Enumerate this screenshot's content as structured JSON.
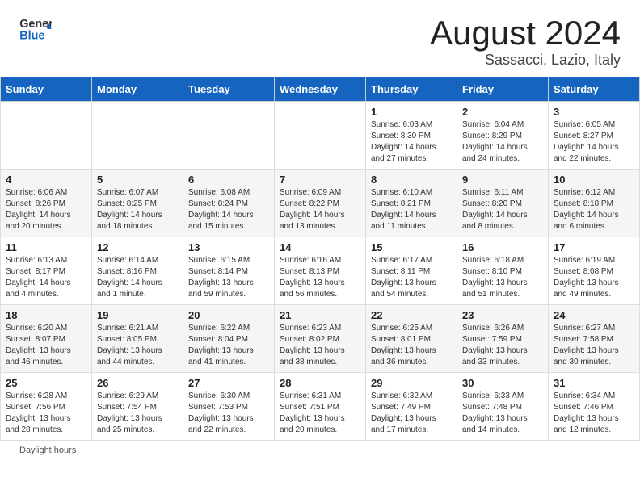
{
  "header": {
    "logo_general": "General",
    "logo_blue": "Blue",
    "title": "August 2024",
    "subtitle": "Sassacci, Lazio, Italy"
  },
  "weekdays": [
    "Sunday",
    "Monday",
    "Tuesday",
    "Wednesday",
    "Thursday",
    "Friday",
    "Saturday"
  ],
  "weeks": [
    [
      {
        "day": "",
        "info": ""
      },
      {
        "day": "",
        "info": ""
      },
      {
        "day": "",
        "info": ""
      },
      {
        "day": "",
        "info": ""
      },
      {
        "day": "1",
        "info": "Sunrise: 6:03 AM\nSunset: 8:30 PM\nDaylight: 14 hours and 27 minutes."
      },
      {
        "day": "2",
        "info": "Sunrise: 6:04 AM\nSunset: 8:29 PM\nDaylight: 14 hours and 24 minutes."
      },
      {
        "day": "3",
        "info": "Sunrise: 6:05 AM\nSunset: 8:27 PM\nDaylight: 14 hours and 22 minutes."
      }
    ],
    [
      {
        "day": "4",
        "info": "Sunrise: 6:06 AM\nSunset: 8:26 PM\nDaylight: 14 hours and 20 minutes."
      },
      {
        "day": "5",
        "info": "Sunrise: 6:07 AM\nSunset: 8:25 PM\nDaylight: 14 hours and 18 minutes."
      },
      {
        "day": "6",
        "info": "Sunrise: 6:08 AM\nSunset: 8:24 PM\nDaylight: 14 hours and 15 minutes."
      },
      {
        "day": "7",
        "info": "Sunrise: 6:09 AM\nSunset: 8:22 PM\nDaylight: 14 hours and 13 minutes."
      },
      {
        "day": "8",
        "info": "Sunrise: 6:10 AM\nSunset: 8:21 PM\nDaylight: 14 hours and 11 minutes."
      },
      {
        "day": "9",
        "info": "Sunrise: 6:11 AM\nSunset: 8:20 PM\nDaylight: 14 hours and 8 minutes."
      },
      {
        "day": "10",
        "info": "Sunrise: 6:12 AM\nSunset: 8:18 PM\nDaylight: 14 hours and 6 minutes."
      }
    ],
    [
      {
        "day": "11",
        "info": "Sunrise: 6:13 AM\nSunset: 8:17 PM\nDaylight: 14 hours and 4 minutes."
      },
      {
        "day": "12",
        "info": "Sunrise: 6:14 AM\nSunset: 8:16 PM\nDaylight: 14 hours and 1 minute."
      },
      {
        "day": "13",
        "info": "Sunrise: 6:15 AM\nSunset: 8:14 PM\nDaylight: 13 hours and 59 minutes."
      },
      {
        "day": "14",
        "info": "Sunrise: 6:16 AM\nSunset: 8:13 PM\nDaylight: 13 hours and 56 minutes."
      },
      {
        "day": "15",
        "info": "Sunrise: 6:17 AM\nSunset: 8:11 PM\nDaylight: 13 hours and 54 minutes."
      },
      {
        "day": "16",
        "info": "Sunrise: 6:18 AM\nSunset: 8:10 PM\nDaylight: 13 hours and 51 minutes."
      },
      {
        "day": "17",
        "info": "Sunrise: 6:19 AM\nSunset: 8:08 PM\nDaylight: 13 hours and 49 minutes."
      }
    ],
    [
      {
        "day": "18",
        "info": "Sunrise: 6:20 AM\nSunset: 8:07 PM\nDaylight: 13 hours and 46 minutes."
      },
      {
        "day": "19",
        "info": "Sunrise: 6:21 AM\nSunset: 8:05 PM\nDaylight: 13 hours and 44 minutes."
      },
      {
        "day": "20",
        "info": "Sunrise: 6:22 AM\nSunset: 8:04 PM\nDaylight: 13 hours and 41 minutes."
      },
      {
        "day": "21",
        "info": "Sunrise: 6:23 AM\nSunset: 8:02 PM\nDaylight: 13 hours and 38 minutes."
      },
      {
        "day": "22",
        "info": "Sunrise: 6:25 AM\nSunset: 8:01 PM\nDaylight: 13 hours and 36 minutes."
      },
      {
        "day": "23",
        "info": "Sunrise: 6:26 AM\nSunset: 7:59 PM\nDaylight: 13 hours and 33 minutes."
      },
      {
        "day": "24",
        "info": "Sunrise: 6:27 AM\nSunset: 7:58 PM\nDaylight: 13 hours and 30 minutes."
      }
    ],
    [
      {
        "day": "25",
        "info": "Sunrise: 6:28 AM\nSunset: 7:56 PM\nDaylight: 13 hours and 28 minutes."
      },
      {
        "day": "26",
        "info": "Sunrise: 6:29 AM\nSunset: 7:54 PM\nDaylight: 13 hours and 25 minutes."
      },
      {
        "day": "27",
        "info": "Sunrise: 6:30 AM\nSunset: 7:53 PM\nDaylight: 13 hours and 22 minutes."
      },
      {
        "day": "28",
        "info": "Sunrise: 6:31 AM\nSunset: 7:51 PM\nDaylight: 13 hours and 20 minutes."
      },
      {
        "day": "29",
        "info": "Sunrise: 6:32 AM\nSunset: 7:49 PM\nDaylight: 13 hours and 17 minutes."
      },
      {
        "day": "30",
        "info": "Sunrise: 6:33 AM\nSunset: 7:48 PM\nDaylight: 13 hours and 14 minutes."
      },
      {
        "day": "31",
        "info": "Sunrise: 6:34 AM\nSunset: 7:46 PM\nDaylight: 13 hours and 12 minutes."
      }
    ]
  ],
  "footer": {
    "daylight_label": "Daylight hours"
  }
}
